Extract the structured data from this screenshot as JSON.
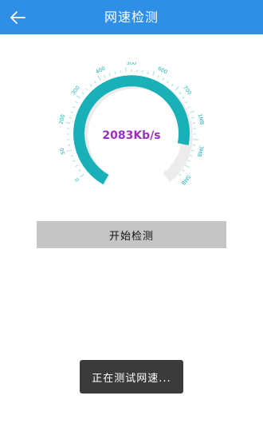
{
  "header": {
    "title": "网速检测",
    "back_icon": "arrow-left-icon"
  },
  "gauge": {
    "speed_text": "2083Kb/s",
    "speed_value_kbps": 2083,
    "tick_labels": [
      "0",
      "50",
      "200",
      "300",
      "400",
      "500",
      "600",
      "700",
      "1MB",
      "3MB",
      "5MB"
    ],
    "accent_color": "#1ab0b8",
    "speed_text_color": "#9b2fc4"
  },
  "actions": {
    "start_label": "开始检测"
  },
  "toast": {
    "text": "正在测试网速..."
  },
  "colors": {
    "header_bg": "#2f8fe6"
  }
}
